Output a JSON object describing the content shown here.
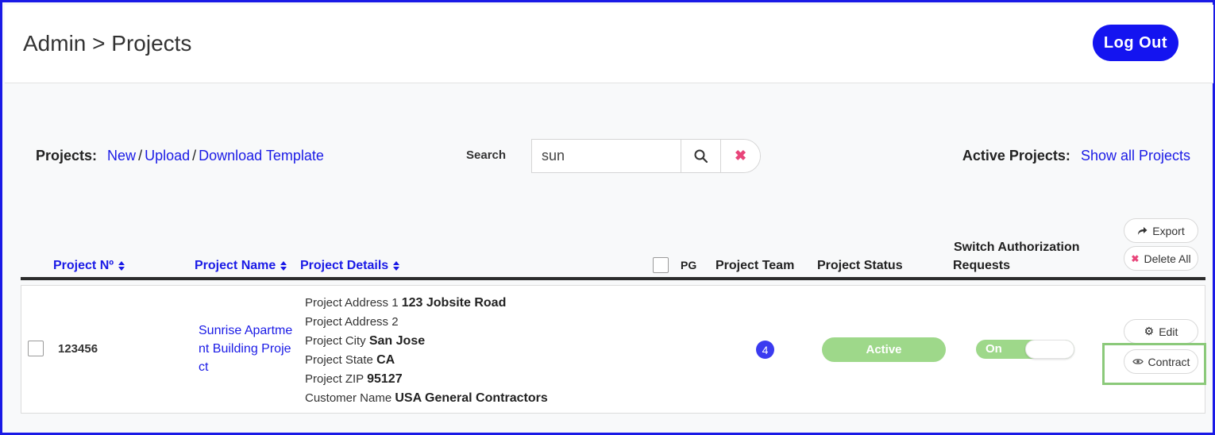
{
  "header": {
    "breadcrumb": "Admin > Projects",
    "logout_label": "Log Out"
  },
  "toolbar": {
    "projects_label": "Projects:",
    "new_link": "New",
    "upload_link": "Upload",
    "download_template_link": "Download Template",
    "separator": "/",
    "search_label": "Search",
    "search_value": "sun",
    "active_projects_label": "Active Projects:",
    "show_all_link": "Show all Projects"
  },
  "table": {
    "columns": {
      "project_no": "Project Nº",
      "project_name": "Project Name",
      "project_details": "Project Details",
      "pg": "PG",
      "project_team": "Project Team",
      "project_status": "Project Status",
      "switch_auth_line1": "Switch Authorization",
      "switch_auth_line2": "Requests"
    },
    "actions": {
      "export_label": "Export",
      "delete_all_label": "Delete All"
    },
    "rows": [
      {
        "project_no": "123456",
        "project_name": "Sunrise Apartment Building Project",
        "details": {
          "address1_label": "Project Address 1",
          "address1_value": "123 Jobsite Road",
          "address2_label": "Project Address 2",
          "address2_value": "",
          "city_label": "Project City",
          "city_value": "San Jose",
          "state_label": "Project State",
          "state_value": "CA",
          "zip_label": "Project ZIP",
          "zip_value": "95127",
          "customer_label": "Customer Name",
          "customer_value": "USA General Contractors"
        },
        "team_count": "4",
        "status": "Active",
        "switch_auth": "On",
        "edit_label": "Edit",
        "contract_label": "Contract"
      }
    ]
  },
  "colors": {
    "accent": "#1a1ae6",
    "logout_bg": "#1414f0",
    "status_green": "#9ed88a",
    "clear_icon": "#e8457a",
    "highlight_box": "#8bc97a"
  },
  "icons": {
    "search": "search-icon",
    "clear": "close-icon",
    "export": "share-arrow-icon",
    "delete_all": "close-icon",
    "edit": "gear-icon",
    "contract": "eye-icon"
  }
}
